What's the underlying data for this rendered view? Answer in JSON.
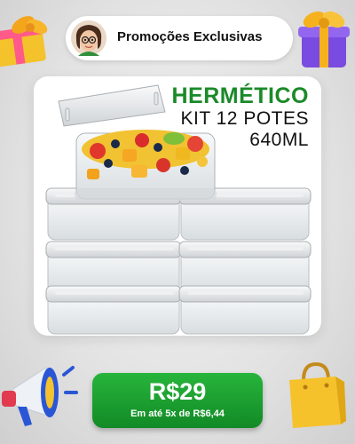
{
  "promo": {
    "label": "Promoções Exclusivas"
  },
  "product": {
    "headline": "HERMÉTICO",
    "kit": "KIT 12 POTES",
    "volume": "640ML"
  },
  "price": {
    "value": "R$29",
    "installments": "Em até 5x de R$6,44"
  },
  "colors": {
    "headline": "#1a8a28",
    "button": "#1f9f33"
  },
  "icons": [
    "avatar",
    "gift-icon",
    "gift-icon",
    "megaphone-icon",
    "shopping-bag-icon"
  ]
}
